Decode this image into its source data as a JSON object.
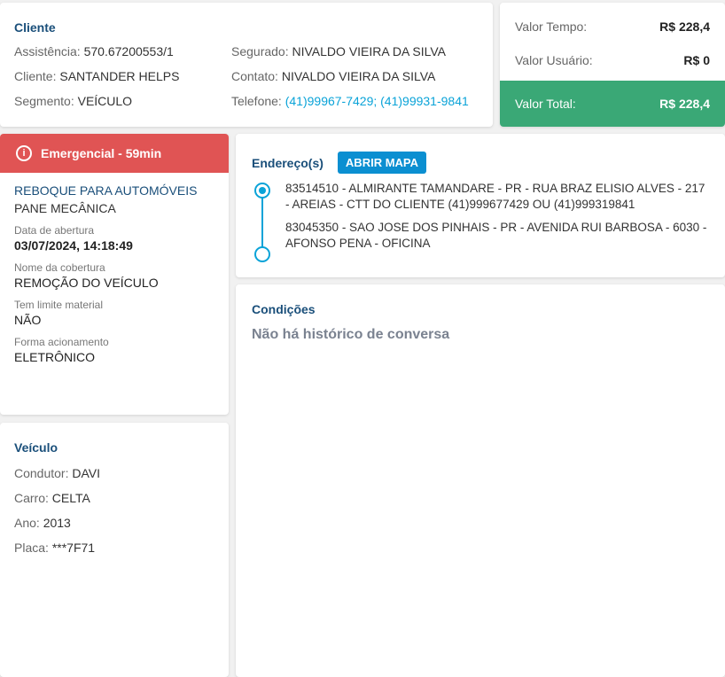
{
  "cliente": {
    "title": "Cliente",
    "assistencia_label": "Assistência:",
    "assistencia_value": "570.67200553/1",
    "cliente_label": "Cliente:",
    "cliente_value": "SANTANDER HELPS",
    "segmento_label": "Segmento:",
    "segmento_value": "VEÍCULO",
    "segurado_label": "Segurado:",
    "segurado_value": "NIVALDO VIEIRA DA SILVA",
    "contato_label": "Contato:",
    "contato_value": "NIVALDO VIEIRA DA SILVA",
    "telefone_label": "Telefone:",
    "telefone_value": "(41)99967-7429; (41)99931-9841"
  },
  "valores": {
    "tempo_label": "Valor Tempo:",
    "tempo_value": "R$ 228,4",
    "usuario_label": "Valor Usuário:",
    "usuario_value": "R$ 0",
    "total_label": "Valor Total:",
    "total_value": "R$ 228,4",
    "total_color": "#3aa876"
  },
  "detalhes": {
    "emergencia_label": "Emergencial - 59min",
    "emergencia_color": "#e05454",
    "servico": "REBOQUE PARA AUTOMÓVEIS",
    "motivo": "PANE MECÂNICA",
    "data_abertura_label": "Data de abertura",
    "data_abertura_value": "03/07/2024, 14:18:49",
    "cobertura_label": "Nome da cobertura",
    "cobertura_value": "REMOÇÃO DO VEÍCULO",
    "limite_label": "Tem limite material",
    "limite_value": "NÃO",
    "acionamento_label": "Forma acionamento",
    "acionamento_value": "ELETRÔNICO"
  },
  "veiculo": {
    "title": "Veículo",
    "condutor_label": "Condutor:",
    "condutor_value": "DAVI",
    "carro_label": "Carro:",
    "carro_value": "CELTA",
    "ano_label": "Ano:",
    "ano_value": "2013",
    "placa_label": "Placa:",
    "placa_value": "***7F71"
  },
  "endereco": {
    "title": "Endereço(s)",
    "button_label": "ABRIR MAPA",
    "origem": "83514510 - ALMIRANTE TAMANDARE - PR - RUA BRAZ ELISIO ALVES - 217 - AREIAS - CTT DO CLIENTE (41)999677429 OU (41)999319841",
    "destino": "83045350 - SAO JOSE DOS PINHAIS - PR - AVENIDA RUI BARBOSA - 6030 - AFONSO PENA - OFICINA"
  },
  "condicoes": {
    "title": "Condições",
    "empty_message": "Não há histórico de conversa"
  },
  "icons": {
    "emergency": "info-circle-icon",
    "timeline_start": "filled-circle-icon",
    "timeline_end": "empty-circle-icon"
  }
}
